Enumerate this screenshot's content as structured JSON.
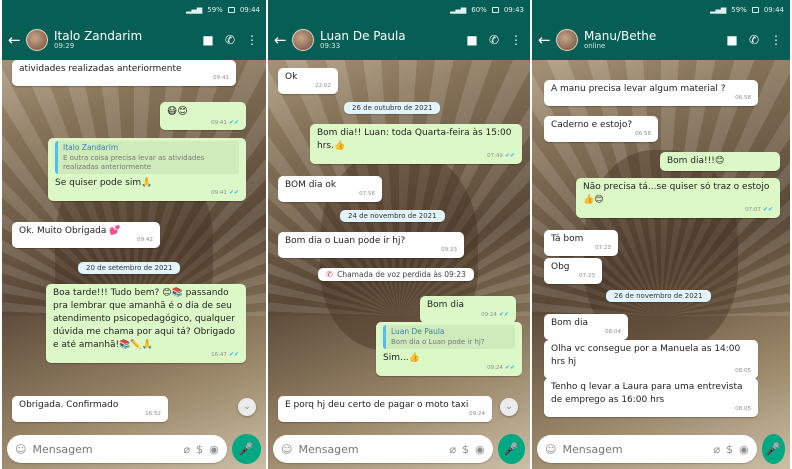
{
  "status": {
    "left_time": "09:44",
    "middle_time": "09:43",
    "right_time": "09:44",
    "left_battery": "59%",
    "middle_battery": "60%",
    "right_battery": "59%"
  },
  "chat1": {
    "name": "Italo Zandarim",
    "subtitle": "09:29",
    "m1": {
      "text": "atividades realizadas anteriormente",
      "time": "09:41"
    },
    "m2": {
      "text": "😷😊",
      "time": "09:41"
    },
    "m3": {
      "quote_name": "Italo Zandarim",
      "quote_text": "E outra coisa precisa levar as atividades realizadas anteriormente",
      "text": "Se quiser pode sim🙏",
      "time": "09:41"
    },
    "m4": {
      "text": "Ok. Muito Obrigada 💕",
      "time": "09:42"
    },
    "date1": "20 de setembro de 2021",
    "m5": {
      "text": "Boa tarde!!! Tudo bem? 😊📚 passando pra lembrar que amanhã é o dia de seu atendimento psicopedagógico, qualquer dúvida me chama por aqui tá? Obrigado e até amanhã!📚✏️🙏",
      "time": "16:47"
    },
    "m6": {
      "text": "Obrigada. Confirmado",
      "time": "16:52"
    },
    "placeholder": "Mensagem"
  },
  "chat2": {
    "name": "Luan De Paula",
    "subtitle": "09:33",
    "m1": {
      "text": "Ok",
      "time": "22:02"
    },
    "date1": "26 de outubro de 2021",
    "m2": {
      "text": "Bom dia!! Luan: toda Quarta-feira às 15:00 hrs.👍",
      "time": "07:49"
    },
    "m3": {
      "text": "BOM dia ok",
      "time": "07:56"
    },
    "date2": "24 de novembro de 2021",
    "m4": {
      "text": "Bom dia o Luan pode ir hj?",
      "time": "09:23"
    },
    "missed": "Chamada de voz perdida às 09:23",
    "m5": {
      "text": "Bom dia",
      "time": "09:24"
    },
    "m6": {
      "quote_name": "Luan De Paula",
      "quote_text": "Bom dia o Luan pode ir hj?",
      "text": "Sim...👍",
      "time": "09:24"
    },
    "m7": {
      "text": "E porq hj deu certo de pagar o moto taxi",
      "time": "09:24"
    },
    "placeholder": "Mensagem"
  },
  "chat3": {
    "name": "Manu/Bethe",
    "subtitle": "online",
    "m1": {
      "text": "A manu precisa levar algum material ?",
      "time": "06:58"
    },
    "m2": {
      "text": "Caderno e estojo?",
      "time": "06:58"
    },
    "m3": {
      "text": "Bom dia!!!😊",
      "time": ""
    },
    "m4": {
      "text": "Não precisa tá...se quiser só traz o estojo👍😊",
      "time": "07:07"
    },
    "m5": {
      "text": "Tá bom",
      "time": "07:23"
    },
    "m6": {
      "text": "Obg",
      "time": "07:23"
    },
    "date1": "26 de novembro de 2021",
    "m7": {
      "text": "Bom dia",
      "time": "08:04"
    },
    "m8": {
      "text": "Olha vc consegue por a Manuela as 14:00 hrs hj",
      "time": "08:05"
    },
    "m9": {
      "text": "Tenho q levar a Laura para uma entrevista de emprego as 16:00 hrs",
      "time": "08:05"
    },
    "placeholder": "Mensagem"
  },
  "icons": {
    "back": "←",
    "video": "■",
    "call": "✆",
    "menu": "⋮",
    "emoji": "☺",
    "attach": "⌀",
    "money": "$",
    "camera": "◉",
    "mic": "🎤",
    "down": "⌄",
    "tick": "✔✔",
    "missed_call": "✆"
  },
  "colors": {
    "header": "#075e54",
    "out_bubble": "#dcf8c6",
    "in_bubble": "#ffffff",
    "mic": "#00a884"
  }
}
